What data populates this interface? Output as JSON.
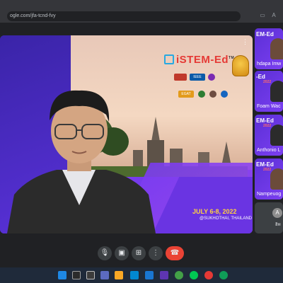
{
  "browser": {
    "url": "ogle.com/jfa-tcnd-fvy"
  },
  "presentation": {
    "logo_text": "iSTEM-Ed",
    "logo_superscript": "TM",
    "sponsors": [
      "IEEE",
      "EGAT"
    ],
    "date_text": "JULY 6-8, 2022",
    "location_text": "@SUKHOTHAI, THAILAND"
  },
  "participants": [
    {
      "logo": "EM-Ed",
      "sub": "",
      "name": "hdapa Imw"
    },
    {
      "logo": "-Ed",
      "sub": "2022",
      "name": "Foam Wac"
    },
    {
      "logo": "EM-Ed",
      "sub": "2022",
      "name": "Anthonio L"
    },
    {
      "logo": "EM-Ed",
      "sub": "2022",
      "name": "Nampeuog"
    }
  ],
  "self_tile": {
    "avatar_letter": "A",
    "label": "อิท"
  },
  "controls": {
    "mic": "mic-icon",
    "camera": "camera-icon",
    "present": "present-icon",
    "more": "more-icon",
    "end": "end-call-icon"
  },
  "colors": {
    "end_call": "#ea4335",
    "accent_purple": "#5a2bd6",
    "date_yellow": "#ffd23f"
  }
}
